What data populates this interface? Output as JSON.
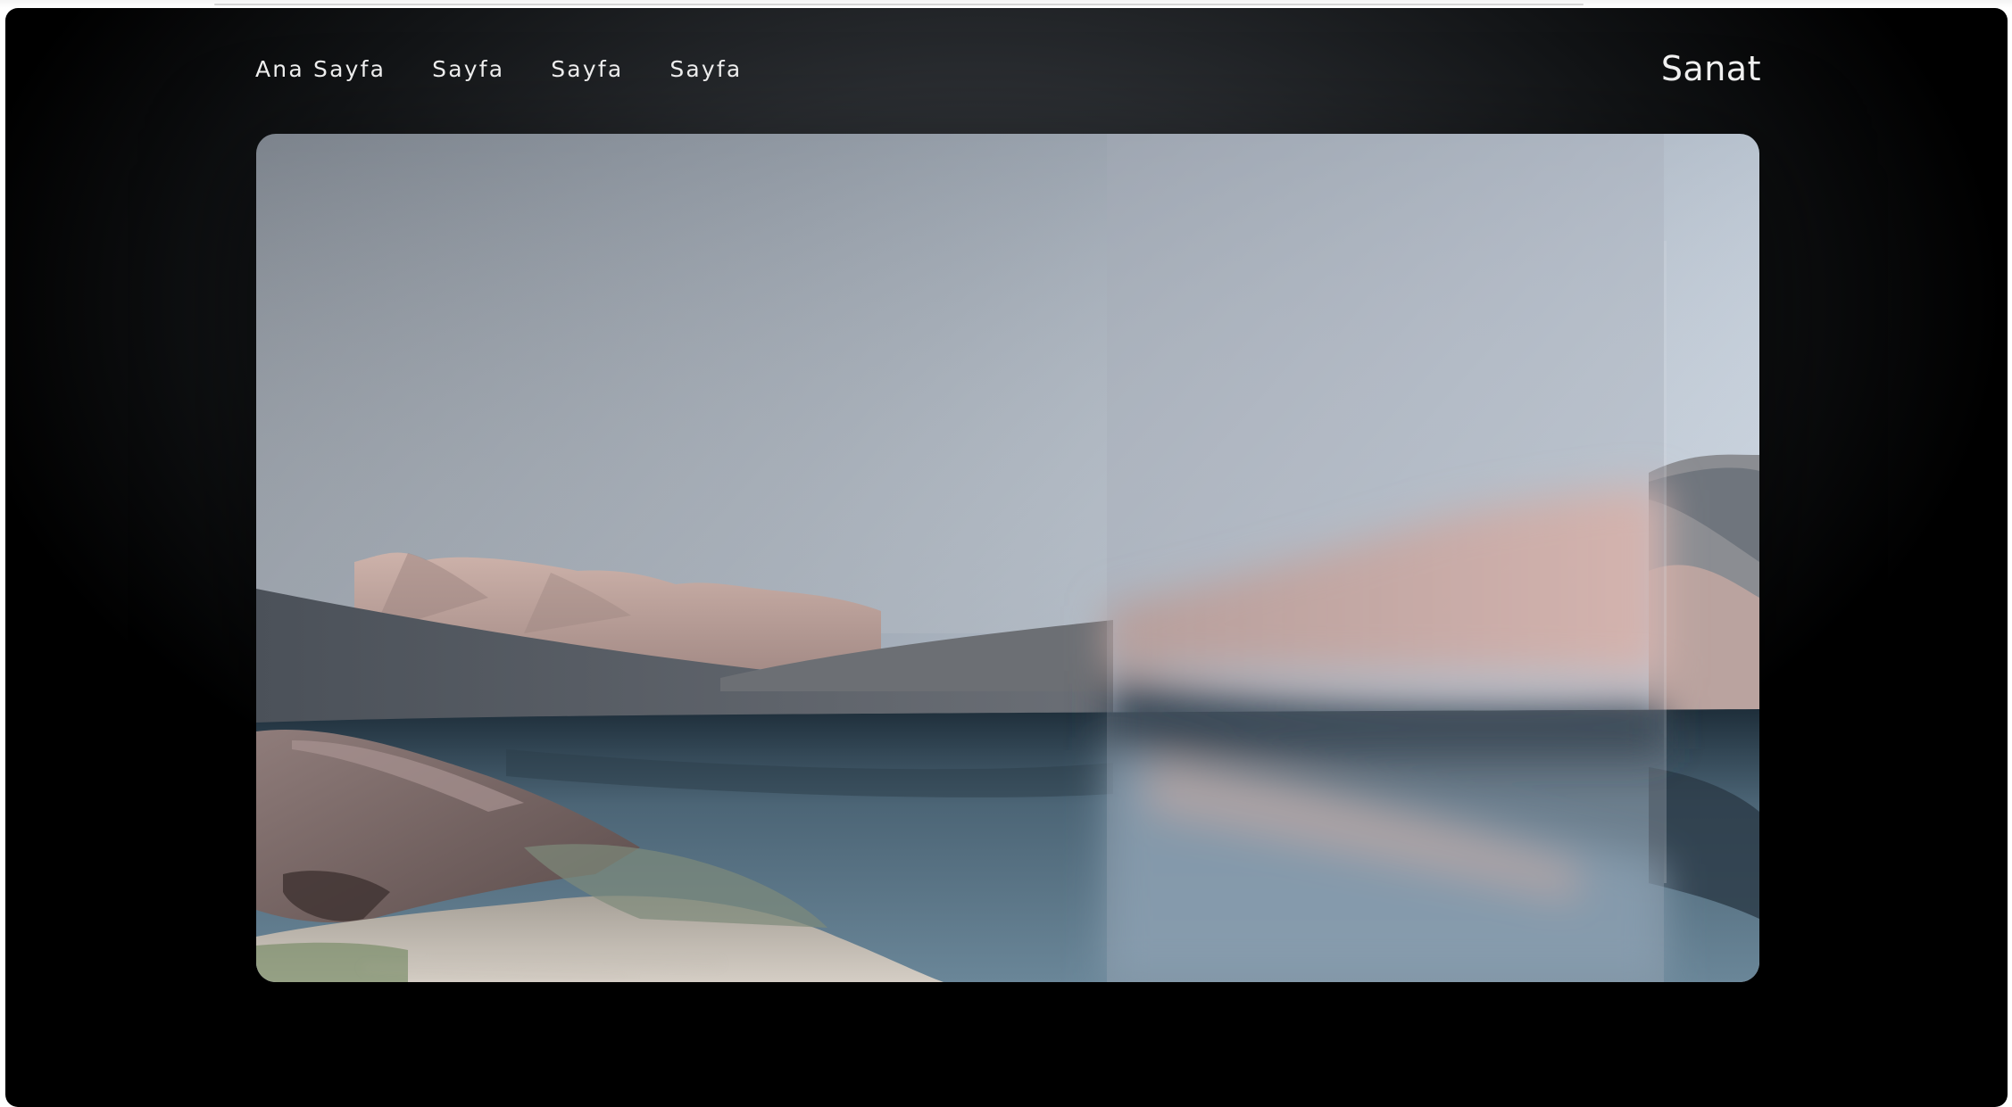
{
  "nav": {
    "items": [
      {
        "label": "Ana Sayfa"
      },
      {
        "label": "Sayfa"
      },
      {
        "label": "Sayfa"
      },
      {
        "label": "Sayfa"
      }
    ]
  },
  "brand": {
    "name": "Sanat"
  },
  "hero": {
    "icon": "landscape-image"
  },
  "colors": {
    "background": "#000000",
    "nav_text": "#f2f2f2",
    "sky": "#a9b4c2",
    "dune": "#c9aaa3",
    "water": "#5f7a8c"
  }
}
